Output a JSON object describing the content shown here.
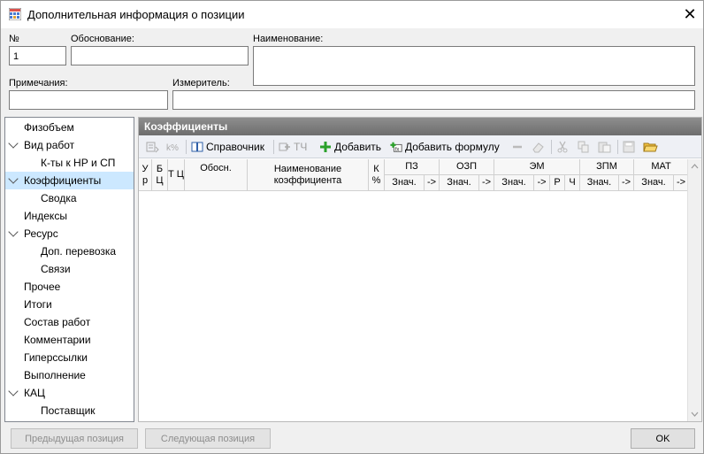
{
  "window": {
    "title": "Дополнительная информация о позиции",
    "close_glyph": "✕"
  },
  "fields": {
    "number": {
      "label": "№",
      "value": "1"
    },
    "justification": {
      "label": "Обоснование:",
      "value": ""
    },
    "name": {
      "label": "Наименование:",
      "value": ""
    },
    "notes": {
      "label": "Примечания:",
      "value": ""
    },
    "unit": {
      "label": "Измеритель:",
      "value": ""
    }
  },
  "tree": [
    {
      "label": "Физобъем"
    },
    {
      "label": "Вид работ"
    },
    {
      "label": "К-ты к НР и СП"
    },
    {
      "label": "Коэффициенты"
    },
    {
      "label": "Сводка"
    },
    {
      "label": "Индексы"
    },
    {
      "label": "Ресурс"
    },
    {
      "label": "Доп. перевозка"
    },
    {
      "label": "Связи"
    },
    {
      "label": "Прочее"
    },
    {
      "label": "Итоги"
    },
    {
      "label": "Состав работ"
    },
    {
      "label": "Комментарии"
    },
    {
      "label": "Гиперссылки"
    },
    {
      "label": "Выполнение"
    },
    {
      "label": "КАЦ"
    },
    {
      "label": "Поставщик"
    }
  ],
  "panel": {
    "title": "Коэффициенты"
  },
  "toolbar": {
    "reference": "Справочник",
    "tch": "ТЧ",
    "add": "Добавить",
    "add_formula": "Добавить формулу"
  },
  "grid": {
    "col_u": "У р",
    "col_b": "Б Ц",
    "col_t": "Т Ц",
    "col_basis": "Обосн.",
    "col_name": "Наименование коэффициента",
    "col_k": "К %",
    "groups": [
      "ПЗ",
      "ОЗП",
      "ЭМ",
      "ЗПМ",
      "МАТ"
    ],
    "val": "Знач.",
    "arrow": "->",
    "r": "Р",
    "ch": "Ч"
  },
  "buttons": {
    "prev": "Предыдущая позиция",
    "next": "Следующая позиция",
    "ok": "OK"
  },
  "colors": {
    "selection": "#cce8ff",
    "header": "#7a7a7a",
    "add_green": "#2aa02a"
  }
}
